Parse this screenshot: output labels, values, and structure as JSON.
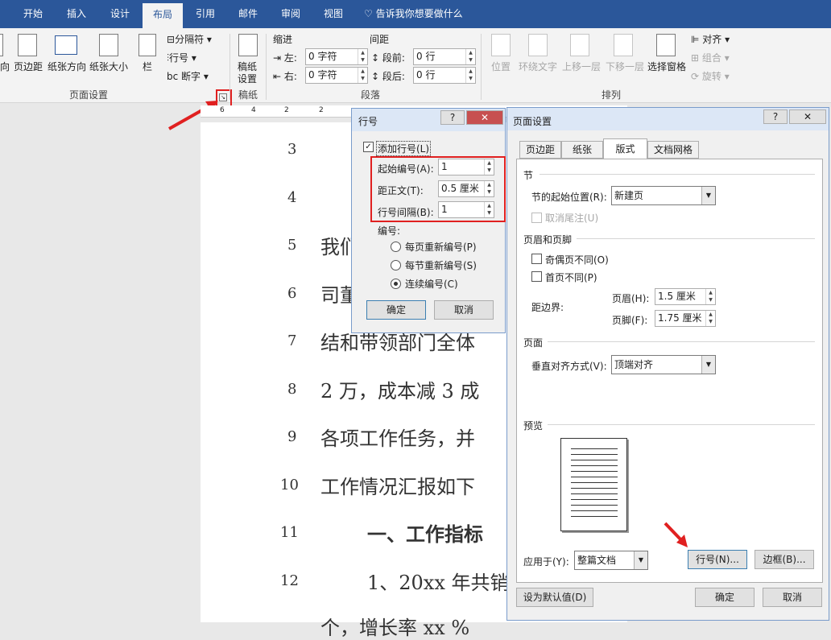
{
  "ribbon": {
    "tabs": [
      {
        "label": "开始"
      },
      {
        "label": "插入"
      },
      {
        "label": "设计"
      },
      {
        "label": "布局"
      },
      {
        "label": "引用"
      },
      {
        "label": "邮件"
      },
      {
        "label": "审阅"
      },
      {
        "label": "视图"
      }
    ],
    "tell_me": "告诉我你想要做什么",
    "page_setup": {
      "text_direction": "向",
      "margins": "页边距",
      "orientation": "纸张方向",
      "size": "纸张大小",
      "columns": "栏",
      "breaks": "分隔符",
      "line_numbers": "行号",
      "hyphenation": "断字",
      "group": "页面设置"
    },
    "draft": {
      "label1": "稿纸",
      "label2": "设置",
      "group": "稿纸"
    },
    "paragraph": {
      "indent": "缩进",
      "spacing": "间距",
      "left_label": "左:",
      "left_value": "0 字符",
      "right_label": "右:",
      "right_value": "0 字符",
      "before_label": "段前:",
      "before_value": "0 行",
      "after_label": "段后:",
      "after_value": "0 行",
      "group": "段落"
    },
    "arrange": {
      "position": "位置",
      "wrap": "环绕文字",
      "forward": "上移一层",
      "backward": "下移一层",
      "pane": "选择窗格",
      "align": "对齐",
      "group_cmd": "组合",
      "rotate": "旋转",
      "group": "排列"
    }
  },
  "ruler": {
    "labels": [
      "6",
      "4",
      "2",
      "2"
    ]
  },
  "document": {
    "line_numbers": [
      "3",
      "4",
      "5",
      "6",
      "7",
      "8",
      "9",
      "10",
      "11",
      "12"
    ],
    "lines": [
      "我们",
      "司董",
      "结和带领部门全体",
      "2 万，成本减 3 成",
      "各项工作任务，并",
      "工作情况汇报如下",
      "一、工作指标",
      "1、20xx 年共销",
      "个，增长率 xx %"
    ]
  },
  "line_num_dialog": {
    "title": "行号",
    "add_line_numbers": "添加行号(L)",
    "start_at_label": "起始编号(A):",
    "start_at_value": "1",
    "from_text_label": "距正文(T):",
    "from_text_value": "0.5 厘米",
    "count_by_label": "行号间隔(B):",
    "count_by_value": "1",
    "numbering_label": "编号:",
    "restart_page": "每页重新编号(P)",
    "restart_section": "每节重新编号(S)",
    "continuous": "连续编号(C)",
    "ok": "确定",
    "cancel": "取消"
  },
  "page_setup_dialog": {
    "title": "页面设置",
    "tabs": [
      {
        "label": "页边距"
      },
      {
        "label": "纸张"
      },
      {
        "label": "版式"
      },
      {
        "label": "文档网格"
      }
    ],
    "section": "节",
    "section_start_label": "节的起始位置(R):",
    "section_start_value": "新建页",
    "suppress_endnotes": "取消尾注(U)",
    "headers_footers": "页眉和页脚",
    "odd_even": "奇偶页不同(O)",
    "first_page": "首页不同(P)",
    "from_edge": "距边界:",
    "header_label": "页眉(H):",
    "header_value": "1.5 厘米",
    "footer_label": "页脚(F):",
    "footer_value": "1.75 厘米",
    "page": "页面",
    "valign_label": "垂直对齐方式(V):",
    "valign_value": "顶端对齐",
    "preview": "预览",
    "apply_to_label": "应用于(Y):",
    "apply_to_value": "整篇文档",
    "line_numbers_btn": "行号(N)...",
    "borders_btn": "边框(B)...",
    "set_default": "设为默认值(D)",
    "ok": "确定",
    "cancel": "取消"
  }
}
